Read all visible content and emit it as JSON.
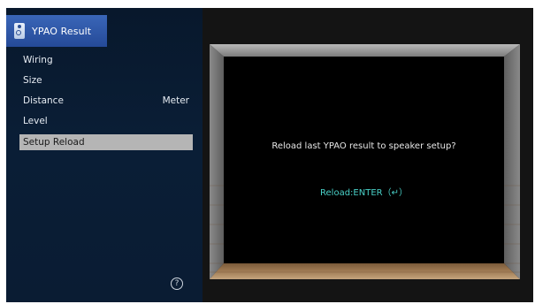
{
  "title_bar": {
    "icon": "speaker-icon",
    "title": "YPAO Result"
  },
  "menu": {
    "items": [
      {
        "label": "Wiring",
        "value": ""
      },
      {
        "label": "Size",
        "value": ""
      },
      {
        "label": "Distance",
        "value": "Meter"
      },
      {
        "label": "Level",
        "value": ""
      },
      {
        "label": "Setup Reload",
        "value": ""
      }
    ],
    "selected": "Setup Reload"
  },
  "help": {
    "icon": "help-icon",
    "glyph": "?"
  },
  "dialog": {
    "message": "Reload last YPAO result to speaker setup?",
    "action": "Reload:ENTER（↵）"
  },
  "colors": {
    "title_bar": "#2d56a8",
    "sidebar": "#0a1c33",
    "selected_row": "#b5b5b5",
    "action_text": "#49d1c8",
    "screen": "#000000"
  }
}
